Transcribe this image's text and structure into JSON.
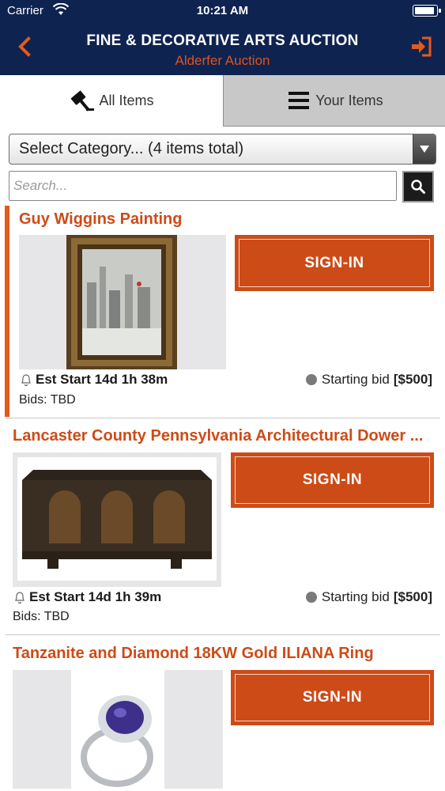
{
  "status_bar": {
    "carrier": "Carrier",
    "time": "10:21 AM"
  },
  "nav": {
    "title": "FINE & DECORATIVE ARTS AUCTION",
    "subtitle": "Alderfer Auction"
  },
  "tabs": [
    {
      "label": "All Items",
      "icon": "gavel-icon",
      "selected": true
    },
    {
      "label": "Your Items",
      "icon": "menu-icon",
      "selected": false
    }
  ],
  "category_select": {
    "value": "Select Category... (4 items total)"
  },
  "search": {
    "placeholder": "Search..."
  },
  "items": [
    {
      "name": "Guy Wiggins Painting",
      "button": "SIGN-IN",
      "est_start": "Est Start 14d 1h 38m",
      "bid_label": "Starting bid",
      "bid_value": "[$500]",
      "bids": "Bids: TBD"
    },
    {
      "name": "Lancaster County Pennsylvania Architectural Dower ...",
      "button": "SIGN-IN",
      "est_start": "Est Start 14d 1h 39m",
      "bid_label": "Starting bid",
      "bid_value": "[$500]",
      "bids": "Bids: TBD"
    },
    {
      "name": "Tanzanite and Diamond 18KW Gold ILIANA Ring",
      "button": "SIGN-IN"
    }
  ],
  "colors": {
    "navy": "#0f2350",
    "accent": "#cd4b17"
  }
}
